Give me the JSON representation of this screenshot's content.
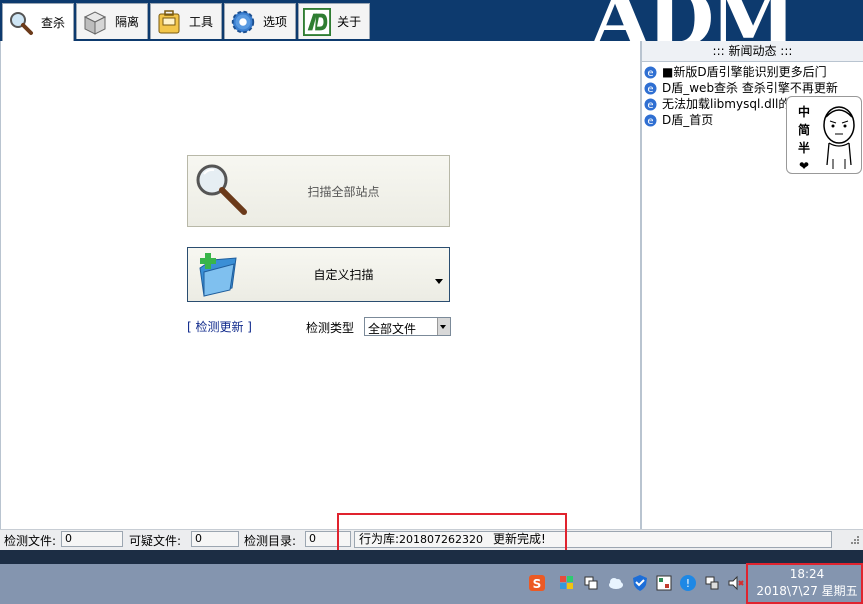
{
  "tabs": [
    {
      "label": "查杀",
      "icon": "magnifier-icon",
      "active": true
    },
    {
      "label": "隔离",
      "icon": "box-icon",
      "active": false
    },
    {
      "label": "工具",
      "icon": "toolbox-icon",
      "active": false
    },
    {
      "label": "选项",
      "icon": "gear-icon",
      "active": false
    },
    {
      "label": "关于",
      "icon": "d-shield-logo-icon",
      "active": false
    }
  ],
  "main": {
    "scan_all_label": "扫描全部站点",
    "custom_scan_label": "自定义扫描",
    "update_link": "[ 检测更新 ]",
    "type_label": "检测类型",
    "type_value": "全部文件"
  },
  "news": {
    "title": "::: 新闻动态 :::",
    "items": [
      "■新版D盾引擎能识别更多后门",
      "D盾_web查杀 查杀引擎不再更新",
      "无法加载libmysql.dll的方法",
      "D盾_首页"
    ]
  },
  "sticker": {
    "chars": [
      "中",
      "简",
      "半",
      "❤"
    ]
  },
  "status": {
    "files_label": "检测文件:",
    "files_value": "0",
    "suspicious_label": "可疑文件:",
    "suspicious_value": "0",
    "dirs_label": "检测目录:",
    "dirs_value": "0",
    "rule_label": "行为库:",
    "rule_version": "201807262320",
    "update_done": "更新完成!"
  },
  "clock": {
    "time": "18:24",
    "date": "2018\\7\\27 星期五"
  },
  "colors": {
    "header": "#0d3a6e",
    "taskbar": "#8495af",
    "highlight": "#e0232e"
  }
}
